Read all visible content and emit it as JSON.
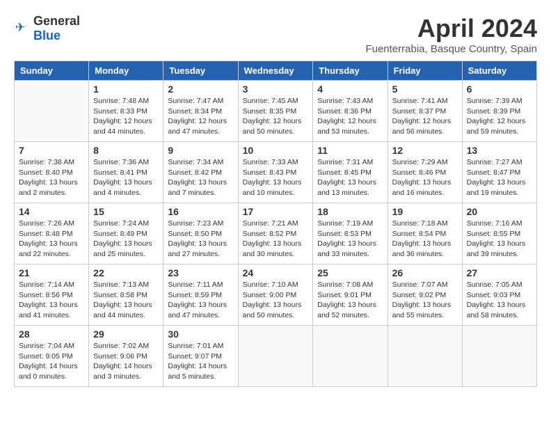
{
  "header": {
    "logo_general": "General",
    "logo_blue": "Blue",
    "month_year": "April 2024",
    "location": "Fuenterrabia, Basque Country, Spain"
  },
  "days_of_week": [
    "Sunday",
    "Monday",
    "Tuesday",
    "Wednesday",
    "Thursday",
    "Friday",
    "Saturday"
  ],
  "weeks": [
    [
      {
        "day": "",
        "info": ""
      },
      {
        "day": "1",
        "info": "Sunrise: 7:48 AM\nSunset: 8:33 PM\nDaylight: 12 hours\nand 44 minutes."
      },
      {
        "day": "2",
        "info": "Sunrise: 7:47 AM\nSunset: 8:34 PM\nDaylight: 12 hours\nand 47 minutes."
      },
      {
        "day": "3",
        "info": "Sunrise: 7:45 AM\nSunset: 8:35 PM\nDaylight: 12 hours\nand 50 minutes."
      },
      {
        "day": "4",
        "info": "Sunrise: 7:43 AM\nSunset: 8:36 PM\nDaylight: 12 hours\nand 53 minutes."
      },
      {
        "day": "5",
        "info": "Sunrise: 7:41 AM\nSunset: 8:37 PM\nDaylight: 12 hours\nand 56 minutes."
      },
      {
        "day": "6",
        "info": "Sunrise: 7:39 AM\nSunset: 8:39 PM\nDaylight: 12 hours\nand 59 minutes."
      }
    ],
    [
      {
        "day": "7",
        "info": "Sunrise: 7:38 AM\nSunset: 8:40 PM\nDaylight: 13 hours\nand 2 minutes."
      },
      {
        "day": "8",
        "info": "Sunrise: 7:36 AM\nSunset: 8:41 PM\nDaylight: 13 hours\nand 4 minutes."
      },
      {
        "day": "9",
        "info": "Sunrise: 7:34 AM\nSunset: 8:42 PM\nDaylight: 13 hours\nand 7 minutes."
      },
      {
        "day": "10",
        "info": "Sunrise: 7:33 AM\nSunset: 8:43 PM\nDaylight: 13 hours\nand 10 minutes."
      },
      {
        "day": "11",
        "info": "Sunrise: 7:31 AM\nSunset: 8:45 PM\nDaylight: 13 hours\nand 13 minutes."
      },
      {
        "day": "12",
        "info": "Sunrise: 7:29 AM\nSunset: 8:46 PM\nDaylight: 13 hours\nand 16 minutes."
      },
      {
        "day": "13",
        "info": "Sunrise: 7:27 AM\nSunset: 8:47 PM\nDaylight: 13 hours\nand 19 minutes."
      }
    ],
    [
      {
        "day": "14",
        "info": "Sunrise: 7:26 AM\nSunset: 8:48 PM\nDaylight: 13 hours\nand 22 minutes."
      },
      {
        "day": "15",
        "info": "Sunrise: 7:24 AM\nSunset: 8:49 PM\nDaylight: 13 hours\nand 25 minutes."
      },
      {
        "day": "16",
        "info": "Sunrise: 7:23 AM\nSunset: 8:50 PM\nDaylight: 13 hours\nand 27 minutes."
      },
      {
        "day": "17",
        "info": "Sunrise: 7:21 AM\nSunset: 8:52 PM\nDaylight: 13 hours\nand 30 minutes."
      },
      {
        "day": "18",
        "info": "Sunrise: 7:19 AM\nSunset: 8:53 PM\nDaylight: 13 hours\nand 33 minutes."
      },
      {
        "day": "19",
        "info": "Sunrise: 7:18 AM\nSunset: 8:54 PM\nDaylight: 13 hours\nand 36 minutes."
      },
      {
        "day": "20",
        "info": "Sunrise: 7:16 AM\nSunset: 8:55 PM\nDaylight: 13 hours\nand 39 minutes."
      }
    ],
    [
      {
        "day": "21",
        "info": "Sunrise: 7:14 AM\nSunset: 8:56 PM\nDaylight: 13 hours\nand 41 minutes."
      },
      {
        "day": "22",
        "info": "Sunrise: 7:13 AM\nSunset: 8:58 PM\nDaylight: 13 hours\nand 44 minutes."
      },
      {
        "day": "23",
        "info": "Sunrise: 7:11 AM\nSunset: 8:59 PM\nDaylight: 13 hours\nand 47 minutes."
      },
      {
        "day": "24",
        "info": "Sunrise: 7:10 AM\nSunset: 9:00 PM\nDaylight: 13 hours\nand 50 minutes."
      },
      {
        "day": "25",
        "info": "Sunrise: 7:08 AM\nSunset: 9:01 PM\nDaylight: 13 hours\nand 52 minutes."
      },
      {
        "day": "26",
        "info": "Sunrise: 7:07 AM\nSunset: 9:02 PM\nDaylight: 13 hours\nand 55 minutes."
      },
      {
        "day": "27",
        "info": "Sunrise: 7:05 AM\nSunset: 9:03 PM\nDaylight: 13 hours\nand 58 minutes."
      }
    ],
    [
      {
        "day": "28",
        "info": "Sunrise: 7:04 AM\nSunset: 9:05 PM\nDaylight: 14 hours\nand 0 minutes."
      },
      {
        "day": "29",
        "info": "Sunrise: 7:02 AM\nSunset: 9:06 PM\nDaylight: 14 hours\nand 3 minutes."
      },
      {
        "day": "30",
        "info": "Sunrise: 7:01 AM\nSunset: 9:07 PM\nDaylight: 14 hours\nand 5 minutes."
      },
      {
        "day": "",
        "info": ""
      },
      {
        "day": "",
        "info": ""
      },
      {
        "day": "",
        "info": ""
      },
      {
        "day": "",
        "info": ""
      }
    ]
  ]
}
